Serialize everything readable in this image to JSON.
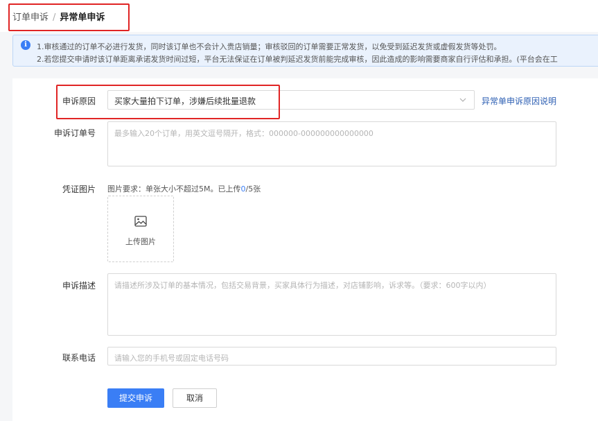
{
  "breadcrumb": {
    "parent": "订单申诉",
    "separator": "/",
    "current": "异常单申诉"
  },
  "notice": {
    "icon": "info-icon",
    "icon_glyph": "i",
    "line1": "1.审核通过的订单不必进行发货，同时该订单也不会计入贵店销量；审核驳回的订单需要正常发货，以免受到延迟发货或虚假发货等处罚。",
    "line2": "2.若您提交申请时该订单距离承诺发货时间过短，平台无法保证在订单被判延迟发货前能完成审核，因此造成的影响需要商家自行评估和承担。(平台会在工"
  },
  "form": {
    "reason": {
      "label": "申诉原因",
      "selected": "买家大量拍下订单，涉嫌后续批量退款",
      "help_link": "异常单申诉原因说明"
    },
    "order_no": {
      "label": "申诉订单号",
      "placeholder": "最多输入20个订单，用英文逗号隔开，格式：000000-000000000000000"
    },
    "evidence": {
      "label": "凭证图片",
      "hint_prefix": "图片要求：单张大小不超过5M。已上传",
      "uploaded": "0",
      "hint_suffix": "/5张",
      "upload_label": "上传图片"
    },
    "description": {
      "label": "申诉描述",
      "placeholder": "请描述所涉及订单的基本情况，包括交易背景，买家具体行为描述，对店铺影响，诉求等。（要求：600字以内）"
    },
    "phone": {
      "label": "联系电话",
      "placeholder": "请输入您的手机号或固定电话号码"
    }
  },
  "actions": {
    "submit": "提交申诉",
    "cancel": "取消"
  },
  "colors": {
    "primary": "#3a7ef5",
    "link": "#2d5fb3",
    "highlight": "#e02424",
    "notice_bg": "#eaf2fd"
  }
}
